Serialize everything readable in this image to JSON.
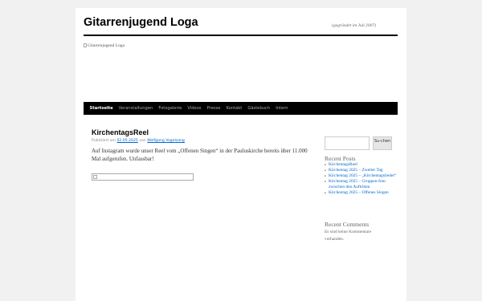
{
  "site": {
    "title": "Gitarrenjugend Loga",
    "description": "(gegründet im Juli 2007)",
    "header_image_alt": "Gitarrenjugend Loga"
  },
  "menu": {
    "items": [
      {
        "label": "Startseite",
        "active": true
      },
      {
        "label": "Veranstaltungen",
        "active": false
      },
      {
        "label": "Fotogalerie",
        "active": false
      },
      {
        "label": "Videos",
        "active": false
      },
      {
        "label": "Presse",
        "active": false
      },
      {
        "label": "Kontakt",
        "active": false
      },
      {
        "label": "Gästebuch",
        "active": false
      },
      {
        "label": "Intern",
        "active": false
      }
    ]
  },
  "post": {
    "title": "KirchentagsReel",
    "meta_published": "Publiziert am",
    "meta_date": "02.05.2025",
    "meta_by": "von",
    "meta_author": "Wolfgang Vogelsang",
    "body": "Auf Instagram wurde unser Reel vom „Offenen Singen“ in der Pauluskirche bereits über 11.000 Mal aufgerufen. Unfassbar!"
  },
  "sidebar": {
    "search_button": "Su-chen",
    "recent_posts_title": "Recent Posts",
    "recent_posts": [
      "KirchentagsReel",
      "Kirchentag 2025 – Zweiter Tag",
      "Kirchentag 2025 – „Kirchentagslieder“",
      "Kirchentag 2025 – Gruppen-foto zwischen den Auftritten",
      "Kirchentag 2025 – Offenes Singen"
    ],
    "recent_comments_title": "Recent Comments",
    "no_comments": "Es sind keine Kommentare vorhanden."
  },
  "colors": {
    "background": "#f1f1f1",
    "menu_bar": "#000000",
    "link": "#0066cc"
  }
}
